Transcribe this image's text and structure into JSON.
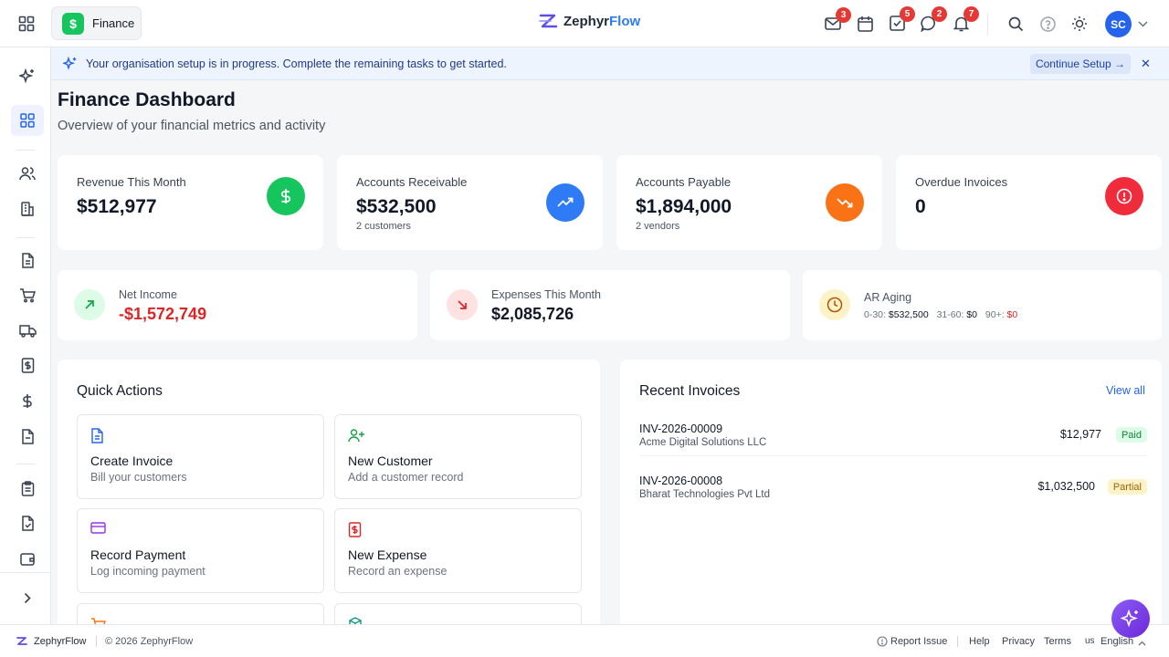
{
  "header": {
    "app_name": "Finance",
    "app_icon_glyph": "$",
    "logo_text_1": "Zephyr",
    "logo_text_2": "Flow",
    "badges": {
      "mail": "3",
      "tasks": "5",
      "chat": "2",
      "notifications": "7"
    },
    "avatar_initials": "SC",
    "brand_color": "#2563eb"
  },
  "banner": {
    "message": "Your organisation setup is in progress. Complete the remaining tasks to get started.",
    "button_label": "Continue Setup →",
    "close_glyph": "✕"
  },
  "page": {
    "title": "Finance Dashboard",
    "subtitle": "Overview of your financial metrics and activity"
  },
  "kpis": [
    {
      "label": "Revenue This Month",
      "value": "$512,977",
      "sub": "",
      "icon": "dollar-icon",
      "color": "#16c55e"
    },
    {
      "label": "Accounts Receivable",
      "value": "$532,500",
      "sub": "2 customers",
      "icon": "trending-up-icon",
      "color": "#2f7bf5"
    },
    {
      "label": "Accounts Payable",
      "value": "$1,894,000",
      "sub": "2 vendors",
      "icon": "trending-down-icon",
      "color": "#f97316"
    },
    {
      "label": "Overdue Invoices",
      "value": "0",
      "sub": "",
      "icon": "alert-circle-icon",
      "color": "#ef2b3c"
    }
  ],
  "metrics": {
    "net_income": {
      "label": "Net Income",
      "value": "-$1,572,749"
    },
    "expenses": {
      "label": "Expenses This Month",
      "value": "$2,085,726"
    },
    "ar_aging": {
      "label": "AR Aging",
      "b1_label": "0-30:",
      "b1_value": "$532,500",
      "b2_label": "31-60:",
      "b2_value": "$0",
      "b3_label": "90+:",
      "b3_value": "$0"
    }
  },
  "quick_actions": {
    "title": "Quick Actions",
    "items": [
      {
        "title": "Create Invoice",
        "desc": "Bill your customers"
      },
      {
        "title": "New Customer",
        "desc": "Add a customer record"
      },
      {
        "title": "Record Payment",
        "desc": "Log incoming payment"
      },
      {
        "title": "New Expense",
        "desc": "Record an expense"
      }
    ]
  },
  "recent_invoices": {
    "title": "Recent Invoices",
    "view_all": "View all",
    "rows": [
      {
        "number": "INV-2026-00009",
        "customer": "Acme Digital Solutions LLC",
        "amount": "$12,977",
        "status": "Paid"
      },
      {
        "number": "INV-2026-00008",
        "customer": "Bharat Technologies Pvt Ltd",
        "amount": "$1,032,500",
        "status": "Partial"
      }
    ]
  },
  "footer": {
    "brand": "ZephyrFlow",
    "copyright": "© 2026 ZephyrFlow",
    "report": "Report Issue",
    "help": "Help",
    "privacy": "Privacy",
    "terms": "Terms",
    "lang_code": "us",
    "language": "English"
  }
}
